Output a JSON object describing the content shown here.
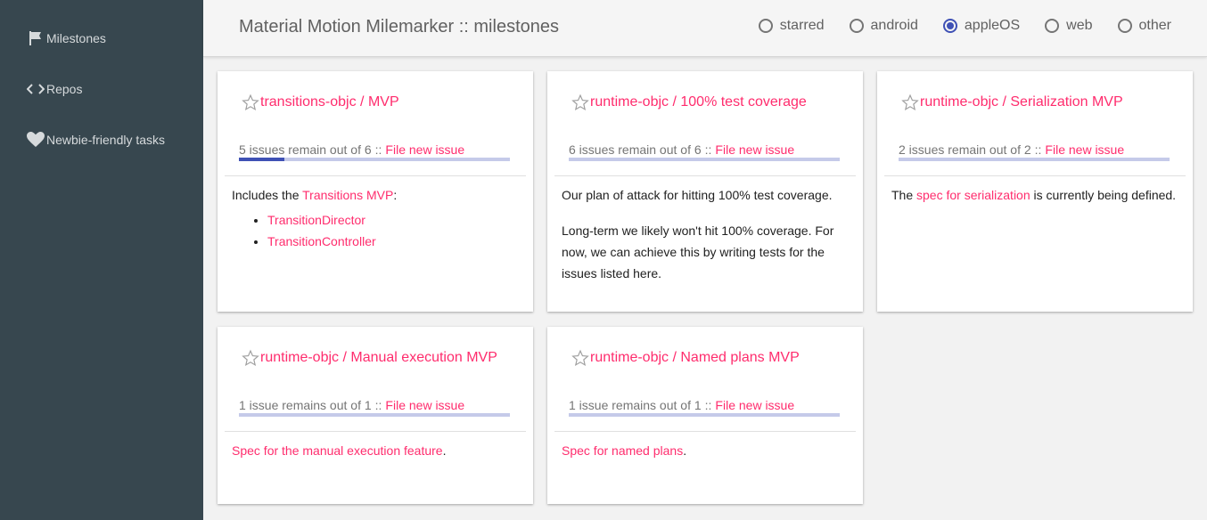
{
  "sidebar": {
    "items": [
      {
        "label": "Milestones",
        "icon": "flag-icon"
      },
      {
        "label": "Repos",
        "icon": "code-icon"
      },
      {
        "label": "Newbie-friendly tasks",
        "icon": "heart-icon"
      }
    ]
  },
  "header": {
    "title": "Material Motion Milemarker :: milestones",
    "filters": [
      {
        "label": "starred",
        "checked": false
      },
      {
        "label": "android",
        "checked": false
      },
      {
        "label": "appleOS",
        "checked": true
      },
      {
        "label": "web",
        "checked": false
      },
      {
        "label": "other",
        "checked": false
      }
    ]
  },
  "colors": {
    "sidebar_bg": "#37474f",
    "link": "#ff2c6d",
    "accent": "#3f51b5",
    "progress_track": "#c5cae9"
  },
  "cards": [
    {
      "title": "transitions-objc / MVP",
      "progress_text": "5 issues remain out of 6",
      "separator": "::",
      "file_issue_label": "File new issue",
      "progress_fraction": 0.1667,
      "body": {
        "intro_prefix": "Includes the ",
        "intro_link": "Transitions MVP",
        "intro_suffix": ":",
        "list": [
          "TransitionDirector",
          "TransitionController"
        ]
      }
    },
    {
      "title": "runtime-objc / 100% test coverage",
      "progress_text": "6 issues remain out of 6",
      "separator": "::",
      "file_issue_label": "File new issue",
      "progress_fraction": 0,
      "body": {
        "p1": "Our plan of attack for hitting 100% test coverage.",
        "p2": "Long-term we likely won't hit 100% coverage. For now, we can achieve this by writing tests for the issues listed here."
      }
    },
    {
      "title": "runtime-objc / Serialization MVP",
      "progress_text": "2 issues remain out of 2",
      "separator": "::",
      "file_issue_label": "File new issue",
      "progress_fraction": 0,
      "body": {
        "prefix": "The ",
        "link": "spec for serialization",
        "suffix": " is currently being defined."
      }
    },
    {
      "title": "runtime-objc / Manual execution MVP",
      "progress_text": "1 issue remains out of 1",
      "separator": "::",
      "file_issue_label": "File new issue",
      "progress_fraction": 0,
      "body": {
        "link": "Spec for the manual execution feature",
        "suffix": "."
      }
    },
    {
      "title": "runtime-objc / Named plans MVP",
      "progress_text": "1 issue remains out of 1",
      "separator": "::",
      "file_issue_label": "File new issue",
      "progress_fraction": 0,
      "body": {
        "link": "Spec for named plans",
        "suffix": "."
      }
    }
  ]
}
